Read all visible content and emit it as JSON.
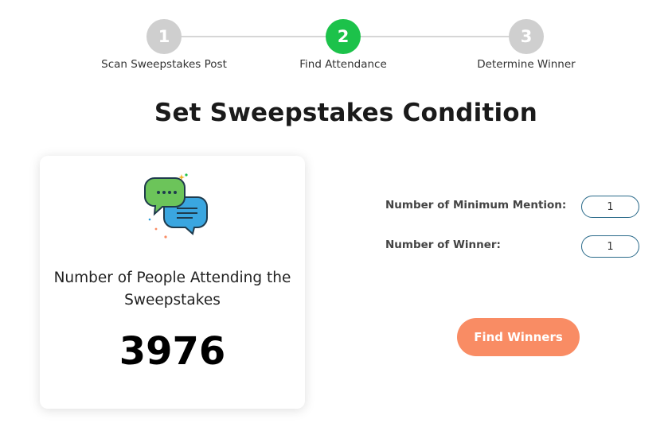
{
  "stepper": {
    "steps": [
      {
        "number": "1",
        "label": "Scan Sweepstakes Post",
        "state": "inactive"
      },
      {
        "number": "2",
        "label": "Find Attendance",
        "state": "active"
      },
      {
        "number": "3",
        "label": "Determine Winner",
        "state": "inactive"
      }
    ]
  },
  "page": {
    "title": "Set Sweepstakes Condition"
  },
  "card": {
    "icon": "chat-bubbles-icon",
    "label": "Number of People Attending the Sweepstakes",
    "count": "3976"
  },
  "form": {
    "min_mention_label": "Number of Minimum Mention:",
    "min_mention_value": "1",
    "winner_label": "Number of Winner:",
    "winner_value": "1"
  },
  "actions": {
    "find_winners_label": "Find Winners"
  },
  "colors": {
    "active_step": "#1cc24a",
    "inactive_step": "#cfcfcf",
    "button": "#f98c64",
    "input_border": "#2a6a8a"
  }
}
